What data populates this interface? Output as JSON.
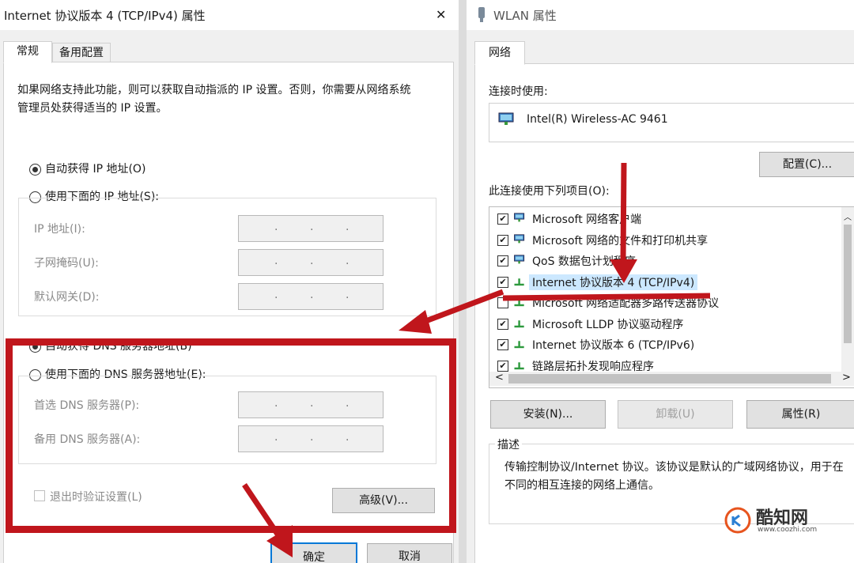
{
  "left_dialog": {
    "title": "Internet 协议版本 4 (TCP/IPv4) 属性",
    "close_glyph": "✕",
    "tabs": [
      "常规",
      "备用配置"
    ],
    "description": "如果网络支持此功能，则可以获取自动指派的 IP 设置。否则，你需要从网络系统管理员处获得适当的 IP 设置。",
    "auto_ip": "自动获得 IP 地址(O)",
    "manual_ip": "使用下面的 IP 地址(S):",
    "ip_label": "IP 地址(I):",
    "mask_label": "子网掩码(U):",
    "gateway_label": "默认网关(D):",
    "auto_dns": "自动获得 DNS 服务器地址(B)",
    "manual_dns": "使用下面的 DNS 服务器地址(E):",
    "preferred_dns": "首选 DNS 服务器(P):",
    "alternate_dns": "备用 DNS 服务器(A):",
    "validate_on_exit": "退出时验证设置(L)",
    "advanced_button": "高级(V)...",
    "ok_button": "确定",
    "cancel_button": "取消",
    "ip_dot": "."
  },
  "right_dialog": {
    "title": "WLAN 属性",
    "tab": "网络",
    "connect_using_label": "连接时使用:",
    "adapter": "Intel(R) Wireless-AC 9461",
    "configure_button": "配置(C)...",
    "items_label": "此连接使用下列项目(O):",
    "items": [
      {
        "label": "Microsoft 网络客户端",
        "checked": true,
        "icon": "network-client-icon"
      },
      {
        "label": "Microsoft 网络的文件和打印机共享",
        "checked": true,
        "icon": "network-client-icon"
      },
      {
        "label": "QoS 数据包计划程序",
        "checked": true,
        "icon": "network-client-icon"
      },
      {
        "label": "Internet 协议版本 4 (TCP/IPv4)",
        "checked": true,
        "icon": "protocol-icon"
      },
      {
        "label": "Microsoft 网络适配器多路传送器协议",
        "checked": false,
        "icon": "protocol-icon"
      },
      {
        "label": "Microsoft LLDP 协议驱动程序",
        "checked": true,
        "icon": "protocol-icon"
      },
      {
        "label": "Internet 协议版本 6 (TCP/IPv6)",
        "checked": true,
        "icon": "protocol-icon"
      },
      {
        "label": "链路层拓扑发现响应程序",
        "checked": true,
        "icon": "protocol-icon"
      }
    ],
    "install_button": "安装(N)...",
    "uninstall_button": "卸载(U)",
    "properties_button": "属性(R)",
    "description_group": "描述",
    "description_text": "传输控制协议/Internet 协议。该协议是默认的广域网络协议，用于在不同的相互连接的网络上通信。",
    "check_glyph": "✔"
  },
  "watermark": {
    "brand": "酷知网",
    "url": "www.coozhi.com"
  },
  "colors": {
    "annotation_red": "#c0161c",
    "focus_blue": "#0078d7",
    "selection": "#cce8ff"
  }
}
